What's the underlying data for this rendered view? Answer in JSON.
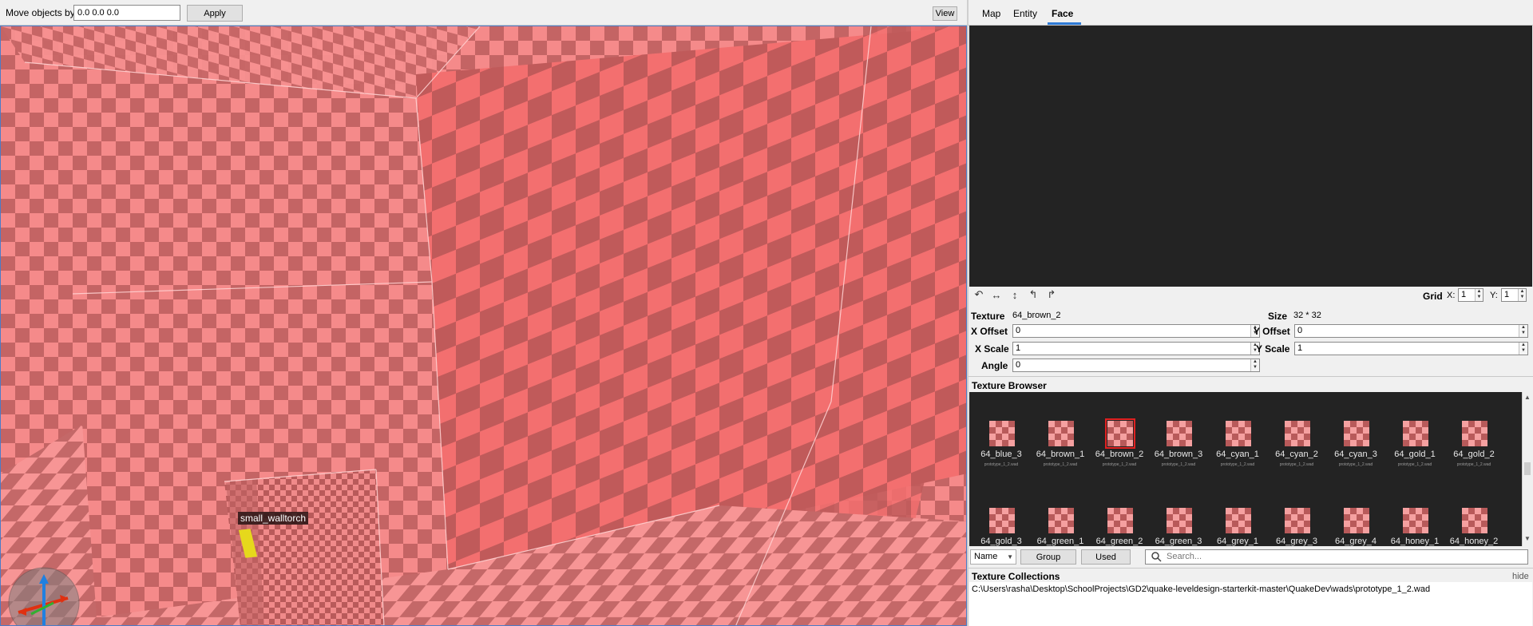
{
  "toolbar": {
    "move_label": "Move objects by",
    "move_value": "0.0 0.0 0.0",
    "apply_label": "Apply",
    "view_label": "View"
  },
  "viewport": {
    "entity_label": "small_walltorch"
  },
  "inspector": {
    "tabs": [
      "Map",
      "Entity",
      "Face"
    ],
    "active_tab": "Face",
    "uv_toolbar": {
      "icons": [
        "rotate-ccw-icon",
        "flip-horizontal-icon",
        "flip-vertical-icon",
        "rotate-left-icon",
        "rotate-right-icon"
      ],
      "grid_label": "Grid",
      "x_label": "X:",
      "x_value": "1",
      "y_label": "Y:",
      "y_value": "1"
    },
    "face": {
      "texture_label": "Texture",
      "texture_value": "64_brown_2",
      "size_label": "Size",
      "size_value": "32 * 32",
      "x_offset_label": "X Offset",
      "x_offset_value": "0",
      "y_offset_label": "Y Offset",
      "y_offset_value": "0",
      "x_scale_label": "X Scale",
      "x_scale_value": "1",
      "y_scale_label": "Y Scale",
      "y_scale_value": "1",
      "angle_label": "Angle",
      "angle_value": "0"
    }
  },
  "texture_browser": {
    "title": "Texture Browser",
    "wad": "prototype_1_2.wad",
    "selected": "64_brown_2",
    "textures": [
      "64_blue_3",
      "64_brown_1",
      "64_brown_2",
      "64_brown_3",
      "64_cyan_1",
      "64_cyan_2",
      "64_cyan_3",
      "64_gold_1",
      "64_gold_2",
      "64_gold_3",
      "64_green_1",
      "64_green_2",
      "64_green_3",
      "64_grey_1",
      "64_grey_3",
      "64_grey_4",
      "64_honey_1",
      "64_honey_2"
    ],
    "sort_value": "Name",
    "group_label": "Group",
    "used_label": "Used",
    "search_placeholder": "Search..."
  },
  "texture_collections": {
    "title": "Texture Collections",
    "hide_label": "hide",
    "items": [
      "C:\\Users\\rasha\\Desktop\\SchoolProjects\\GD2\\quake-leveldesign-starterkit-master\\QuakeDev\\wads\\prototype_1_2.wad"
    ]
  },
  "colors": {
    "accent": "#2f7bd6",
    "selection": "#e02020",
    "checker_light": "#f5a0a0",
    "checker_dark": "#b85a5a"
  }
}
